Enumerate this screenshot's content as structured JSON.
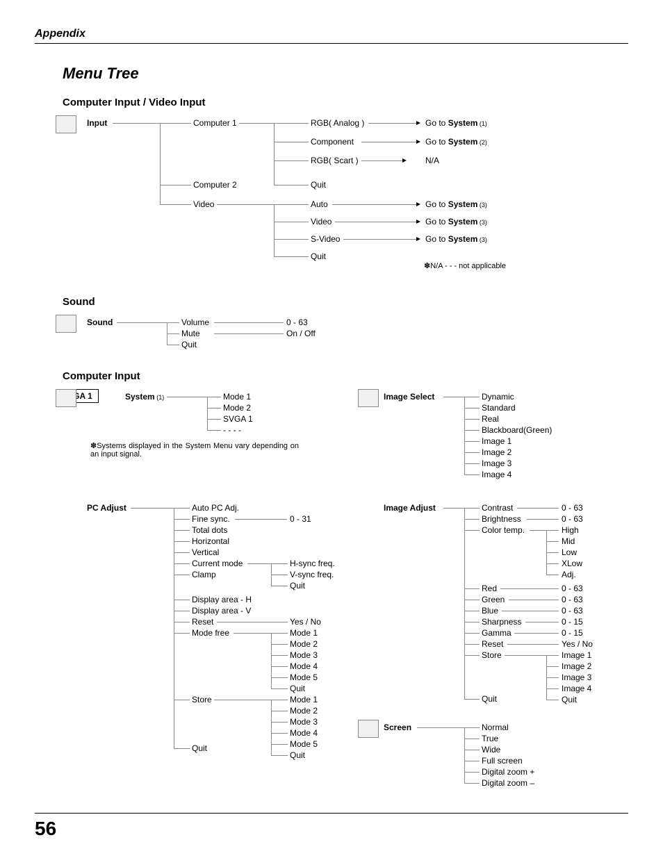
{
  "header": {
    "appendix": "Appendix"
  },
  "title": "Menu Tree",
  "sections": {
    "s1": {
      "heading": "Computer Input / Video Input"
    },
    "s2": {
      "heading": "Sound"
    },
    "s3": {
      "heading": "Computer Input"
    }
  },
  "input": {
    "root": "Input",
    "computer1": "Computer 1",
    "rgb_analog": "RGB( Analog )",
    "component": "Component",
    "rgb_scart": "RGB( Scart )",
    "quit1": "Quit",
    "computer2": "Computer 2",
    "video": "Video",
    "auto": "Auto",
    "video_sub": "Video",
    "svideo": "S-Video",
    "quit2": "Quit",
    "goto_pre": "Go to ",
    "system": "System",
    "ref1": " (1)",
    "ref2": " (2)",
    "ref3": " (3)",
    "na": "N/A",
    "na_note_pre": "✽",
    "na_note": "N/A - - - not applicable"
  },
  "sound": {
    "root": "Sound",
    "volume": "Volume",
    "mute": "Mute",
    "quit": "Quit",
    "volume_range": "0 - 63",
    "mute_range": "On / Off"
  },
  "system": {
    "root_pre": "System",
    "root_ref": " (1)",
    "svga_box": "SVGA 1",
    "mode1": "Mode 1",
    "mode2": "Mode 2",
    "svga1": "SVGA 1",
    "dashes": "- - - -",
    "note_pre": "✽",
    "note": "Systems displayed in the System Menu vary depending on an input signal."
  },
  "image_select": {
    "root": "Image Select",
    "dynamic": "Dynamic",
    "standard": "Standard",
    "real": "Real",
    "blackboard": "Blackboard(Green)",
    "image1": "Image 1",
    "image2": "Image 2",
    "image3": "Image 3",
    "image4": "Image 4"
  },
  "pc_adjust": {
    "root": "PC Adjust",
    "auto": "Auto PC Adj.",
    "fine": "Fine sync.",
    "fine_range": "0 - 31",
    "total": "Total dots",
    "horizontal": "Horizontal",
    "vertical": "Vertical",
    "current": "Current mode",
    "hsync": "H-sync freq.",
    "vsync": "V-sync freq.",
    "quit_cm": "Quit",
    "clamp": "Clamp",
    "disp_h": "Display area - H",
    "disp_v": "Display area - V",
    "reset": "Reset",
    "reset_val": "Yes / No",
    "mode_free": "Mode free",
    "m1": "Mode 1",
    "m2": "Mode 2",
    "m3": "Mode 3",
    "m4": "Mode 4",
    "m5": "Mode 5",
    "quit_mf": "Quit",
    "store": "Store",
    "sm1": "Mode 1",
    "sm2": "Mode 2",
    "sm3": "Mode 3",
    "sm4": "Mode 4",
    "sm5": "Mode 5",
    "quit_st": "Quit",
    "quit": "Quit"
  },
  "image_adjust": {
    "root": "Image Adjust",
    "contrast": "Contrast",
    "contrast_r": "0 - 63",
    "brightness": "Brightness",
    "brightness_r": "0 - 63",
    "colortemp": "Color temp.",
    "high": "High",
    "mid": "Mid",
    "low": "Low",
    "xlow": "XLow",
    "adj": "Adj.",
    "red": "Red",
    "red_r": "0 - 63",
    "green": "Green",
    "green_r": "0 - 63",
    "blue": "Blue",
    "blue_r": "0 - 63",
    "sharpness": "Sharpness",
    "sharpness_r": "0 - 15",
    "gamma": "Gamma",
    "gamma_r": "0 - 15",
    "reset": "Reset",
    "reset_r": "Yes / No",
    "store": "Store",
    "image1": "Image 1",
    "image2": "Image 2",
    "image3": "Image 3",
    "image4": "Image 4",
    "quit_st": "Quit",
    "quit": "Quit"
  },
  "screen": {
    "root": "Screen",
    "normal": "Normal",
    "true": "True",
    "wide": "Wide",
    "full": "Full screen",
    "dzp": "Digital zoom +",
    "dzm": "Digital zoom –"
  },
  "page_number": "56"
}
